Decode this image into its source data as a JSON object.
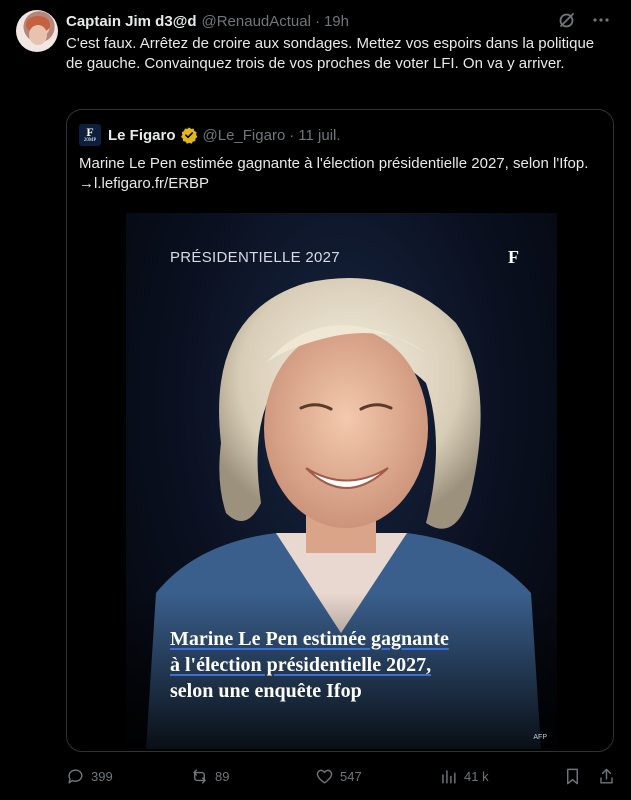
{
  "tweet": {
    "author_name": "Captain Jim d3@d",
    "author_handle": "@RenaudActual",
    "separator": "·",
    "time": "19h",
    "text": "C'est faux. Arrêtez de croire aux sondages. Mettez vos espoirs dans la politique de gauche. Convainquez trois de vos proches de voter LFI. On va y arriver.",
    "icons": [
      "grok-icon",
      "more-icon"
    ]
  },
  "quote": {
    "logo_letter": "F",
    "logo_sub": "20MP",
    "author_name": "Le Figaro",
    "author_handle": "@Le_Figaro",
    "separator": "·",
    "date": "11 juil.",
    "text": "Marine Le Pen estimée gagnante à l'élection présidentielle 2027, selon l'Ifop. →l.lefigaro.fr/ERBP",
    "image": {
      "label": "PRÉSIDENTIELLE 2027",
      "logo": "F",
      "headline_line1": "Marine Le Pen estimée gagnante",
      "headline_line2": "à l'élection présidentielle 2027,",
      "headline_line3": "selon une enquête Ifop",
      "credit": "AFP"
    }
  },
  "actions": {
    "replies": "399",
    "retweets": "89",
    "likes": "547",
    "views": "41 k"
  },
  "colors": {
    "background": "#000000",
    "text": "#e7e9ea",
    "muted": "#71767b",
    "border": "#2f3336",
    "verified": "#e2b719"
  }
}
